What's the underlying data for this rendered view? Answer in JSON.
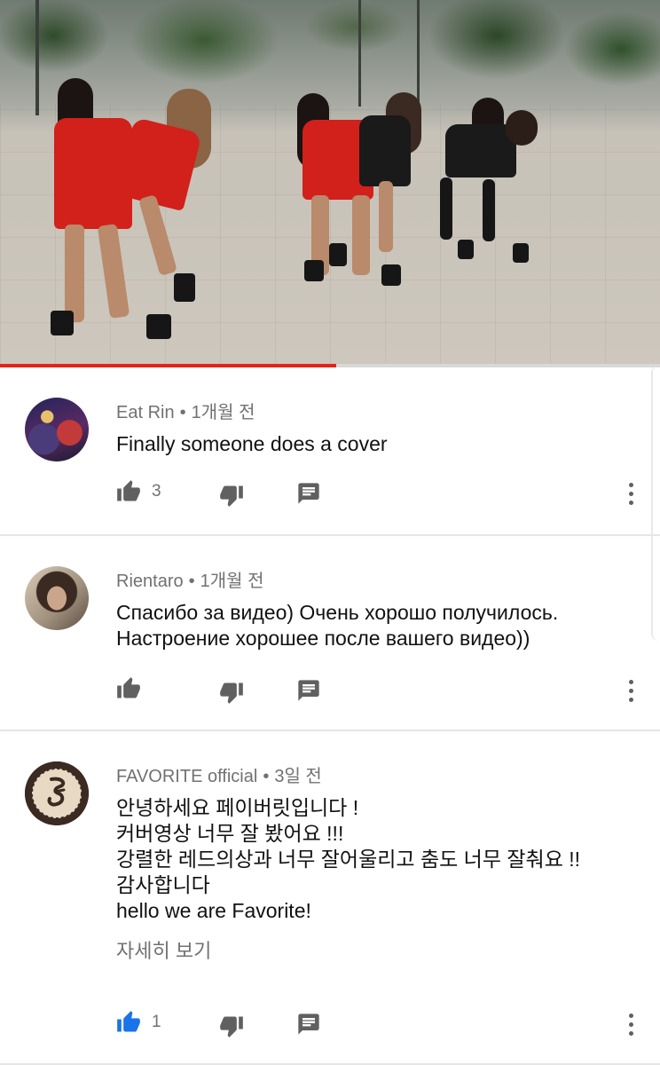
{
  "video": {
    "progress_fraction": 0.51
  },
  "comments": [
    {
      "author": "Eat Rin",
      "time": "1개월 전",
      "lines": [
        "Finally someone does a cover"
      ],
      "likes": "3",
      "liked": false
    },
    {
      "author": "Rientaro",
      "time": "1개월 전",
      "lines": [
        "Спасибо за видео) Очень хорошо получилось.",
        "Настроение хорошее после вашего видео))"
      ],
      "likes": "",
      "liked": false
    },
    {
      "author": "FAVORITE official",
      "time": "3일 전",
      "lines": [
        "안녕하세요 페이버릿입니다 !",
        "커버영상 너무 잘 봤어요 !!!",
        "강렬한 레드의상과 너무 잘어울리고 춤도 너무 잘춰요 !!",
        "감사합니다",
        "hello we are Favorite!"
      ],
      "read_more": "자세히 보기",
      "likes": "1",
      "liked": true
    }
  ],
  "separator": "•",
  "icons": {
    "like": "thumb-up-icon",
    "dislike": "thumb-down-icon",
    "reply": "reply-comment-icon",
    "more": "more-vert-icon"
  },
  "colors": {
    "progress": "#e62117",
    "icon": "#606060",
    "icon_active": "#1a73e8",
    "meta": "#717171"
  }
}
